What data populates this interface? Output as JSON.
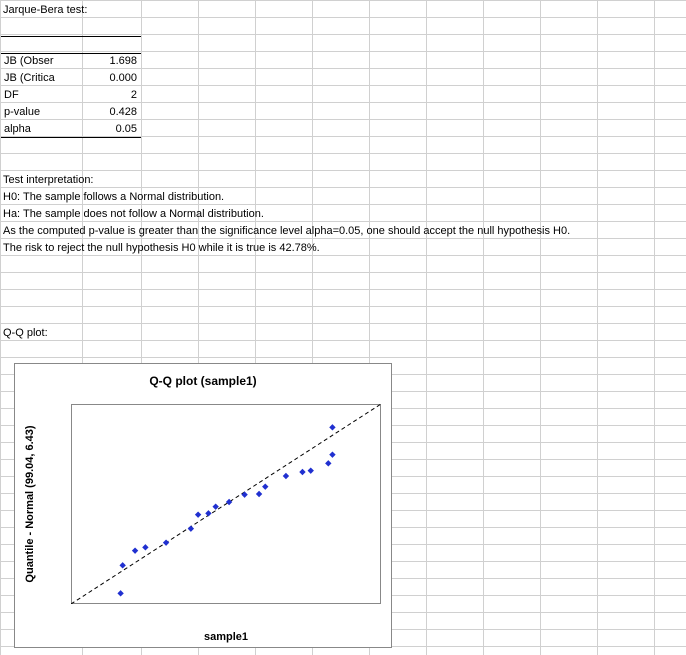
{
  "section1_title": "Jarque-Bera test:",
  "stats": [
    {
      "label": "JB (Observed)",
      "label_short": "JB (Obser",
      "value": "1.698"
    },
    {
      "label": "JB (Critical)",
      "label_short": "JB (Critica",
      "value": "0.000"
    },
    {
      "label": "DF",
      "label_short": "DF",
      "value": "2"
    },
    {
      "label": "p-value",
      "label_short": "p-value",
      "value": "0.428"
    },
    {
      "label": "alpha",
      "label_short": "alpha",
      "value": "0.05"
    }
  ],
  "interp_title": "Test interpretation:",
  "interp_lines": [
    "H0: The sample follows a Normal distribution.",
    "Ha: The sample does not follow a Normal distribution.",
    "As the computed p-value is greater than the significance level alpha=0.05, one should accept the null hypothesis H0.",
    "The risk to reject the null hypothesis H0 while it is true is 42.78%."
  ],
  "qq_label": "Q-Q plot:",
  "chart_data": {
    "type": "scatter",
    "title": "Q-Q plot (sample1)",
    "xlabel": "sample1",
    "ylabel": "Quantile - Normal (99.04, 6.43)",
    "xlim": [
      85,
      115
    ],
    "ylim": [
      85,
      115
    ],
    "xticks": [
      85,
      90,
      95,
      100,
      105,
      110,
      115
    ],
    "yticks": [
      85,
      90,
      95,
      100,
      105,
      110,
      115
    ],
    "series": [
      {
        "name": "sample1",
        "points": [
          {
            "x": 89.8,
            "y": 86.6
          },
          {
            "x": 90.0,
            "y": 90.8
          },
          {
            "x": 91.2,
            "y": 93.0
          },
          {
            "x": 92.2,
            "y": 93.5
          },
          {
            "x": 94.2,
            "y": 94.2
          },
          {
            "x": 96.6,
            "y": 96.3
          },
          {
            "x": 97.3,
            "y": 98.4
          },
          {
            "x": 98.3,
            "y": 98.6
          },
          {
            "x": 99.0,
            "y": 99.6
          },
          {
            "x": 100.3,
            "y": 100.3
          },
          {
            "x": 101.8,
            "y": 101.4
          },
          {
            "x": 103.2,
            "y": 101.5
          },
          {
            "x": 103.8,
            "y": 102.6
          },
          {
            "x": 105.8,
            "y": 104.2
          },
          {
            "x": 107.4,
            "y": 104.8
          },
          {
            "x": 108.2,
            "y": 105.0
          },
          {
            "x": 109.9,
            "y": 106.1
          },
          {
            "x": 110.3,
            "y": 107.4
          },
          {
            "x": 110.3,
            "y": 111.5
          }
        ]
      }
    ],
    "reference_line": {
      "x0": 85,
      "y0": 85,
      "x1": 115,
      "y1": 115
    }
  },
  "colors": {
    "gridline": "#d0d0d0",
    "point": "#2030d0",
    "border": "#888888"
  }
}
